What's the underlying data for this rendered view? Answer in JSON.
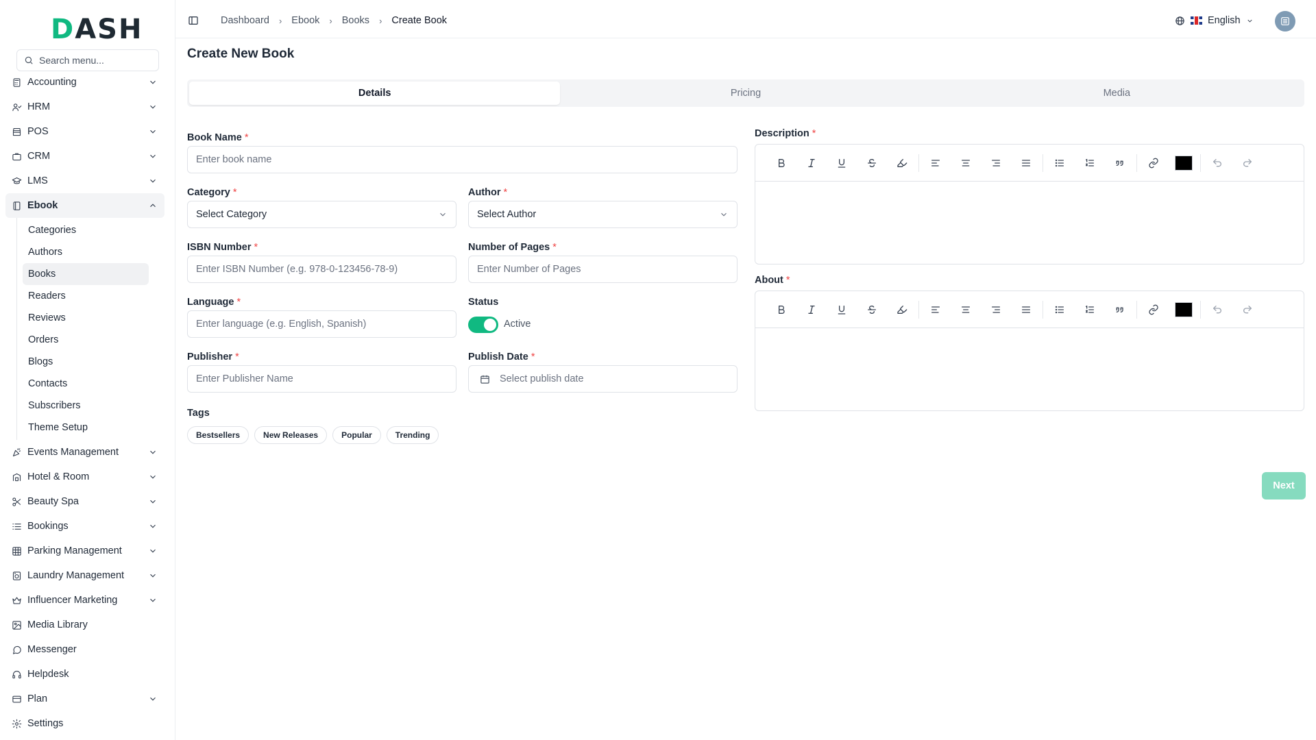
{
  "brand": {
    "logo": "DASH"
  },
  "sidebar": {
    "search_placeholder": "Search menu...",
    "items_top": [
      {
        "label": "Accounting",
        "icon": "calculator-icon",
        "chev": true
      },
      {
        "label": "HRM",
        "icon": "users-icon",
        "chev": true
      },
      {
        "label": "POS",
        "icon": "store-icon",
        "chev": true
      },
      {
        "label": "CRM",
        "icon": "briefcase-icon",
        "chev": true
      },
      {
        "label": "LMS",
        "icon": "graduation-cap-icon",
        "chev": true
      },
      {
        "label": "Ebook",
        "icon": "book-icon",
        "chev": true
      }
    ],
    "ebook_sub": [
      "Categories",
      "Authors",
      "Books",
      "Readers",
      "Reviews",
      "Orders",
      "Blogs",
      "Contacts",
      "Subscribers",
      "Theme Setup"
    ],
    "items_bottom": [
      {
        "label": "Events Management",
        "icon": "party-icon",
        "chev": true
      },
      {
        "label": "Hotel & Room",
        "icon": "hotel-icon",
        "chev": true
      },
      {
        "label": "Beauty Spa",
        "icon": "scissors-icon",
        "chev": true
      },
      {
        "label": "Bookings",
        "icon": "list-icon",
        "chev": true
      },
      {
        "label": "Parking Management",
        "icon": "grid-icon",
        "chev": true
      },
      {
        "label": "Laundry Management",
        "icon": "washing-machine-icon",
        "chev": true
      },
      {
        "label": "Influencer Marketing",
        "icon": "crown-icon",
        "chev": true
      },
      {
        "label": "Media Library",
        "icon": "image-icon",
        "chev": false
      },
      {
        "label": "Messenger",
        "icon": "message-icon",
        "chev": false
      },
      {
        "label": "Helpdesk",
        "icon": "headset-icon",
        "chev": false
      },
      {
        "label": "Plan",
        "icon": "card-icon",
        "chev": true
      },
      {
        "label": "Settings",
        "icon": "gear-icon",
        "chev": false
      }
    ]
  },
  "header": {
    "breadcrumb": [
      "Dashboard",
      "Ebook",
      "Books",
      "Create Book"
    ],
    "language": "English"
  },
  "page": {
    "title": "Create New Book",
    "tabs": [
      "Details",
      "Pricing",
      "Media"
    ]
  },
  "form": {
    "book_name": {
      "label": "Book Name",
      "required": "*",
      "placeholder": "Enter book name"
    },
    "category": {
      "label": "Category",
      "required": "*",
      "value": "Select Category"
    },
    "author": {
      "label": "Author",
      "required": "*",
      "value": "Select Author"
    },
    "isbn": {
      "label": "ISBN Number",
      "required": "*",
      "placeholder": "Enter ISBN Number (e.g. 978-0-123456-78-9)"
    },
    "pages": {
      "label": "Number of Pages",
      "required": "*",
      "placeholder": "Enter Number of Pages"
    },
    "language": {
      "label": "Language",
      "required": "*",
      "placeholder": "Enter language (e.g. English, Spanish)"
    },
    "status": {
      "label": "Status",
      "value": "Active"
    },
    "publisher": {
      "label": "Publisher",
      "required": "*",
      "placeholder": "Enter Publisher Name"
    },
    "publish_date": {
      "label": "Publish Date",
      "required": "*",
      "placeholder": "Select publish date"
    },
    "tags": {
      "label": "Tags",
      "items": [
        "Bestsellers",
        "New Releases",
        "Popular",
        "Trending"
      ]
    },
    "description": {
      "label": "Description",
      "required": "*"
    },
    "about": {
      "label": "About",
      "required": "*"
    },
    "editor_color": "#000000"
  },
  "actions": {
    "next": "Next"
  },
  "colors": {
    "accent": "#10b981",
    "next_disabled": "#86dbbf",
    "required": "#ef4444"
  }
}
